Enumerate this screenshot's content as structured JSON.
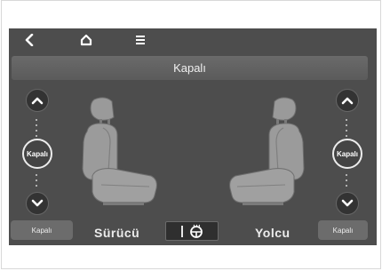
{
  "header": {
    "back_icon": "chevron-left-icon",
    "home_icon": "home-icon",
    "menu_icon": "menu-icon"
  },
  "status": {
    "text": "Kapalı"
  },
  "driver": {
    "label": "Sürücü",
    "level_text": "Kapalı",
    "button_label": "Kapalı"
  },
  "passenger": {
    "label": "Yolcu",
    "level_text": "Kapalı",
    "button_label": "Kapalı"
  },
  "center_button": {
    "icon": "steering-wheel-heat-icon"
  },
  "colors": {
    "screen_bg": "#4d4d4d",
    "seat": "#9a9a9a",
    "text": "#ececec"
  }
}
